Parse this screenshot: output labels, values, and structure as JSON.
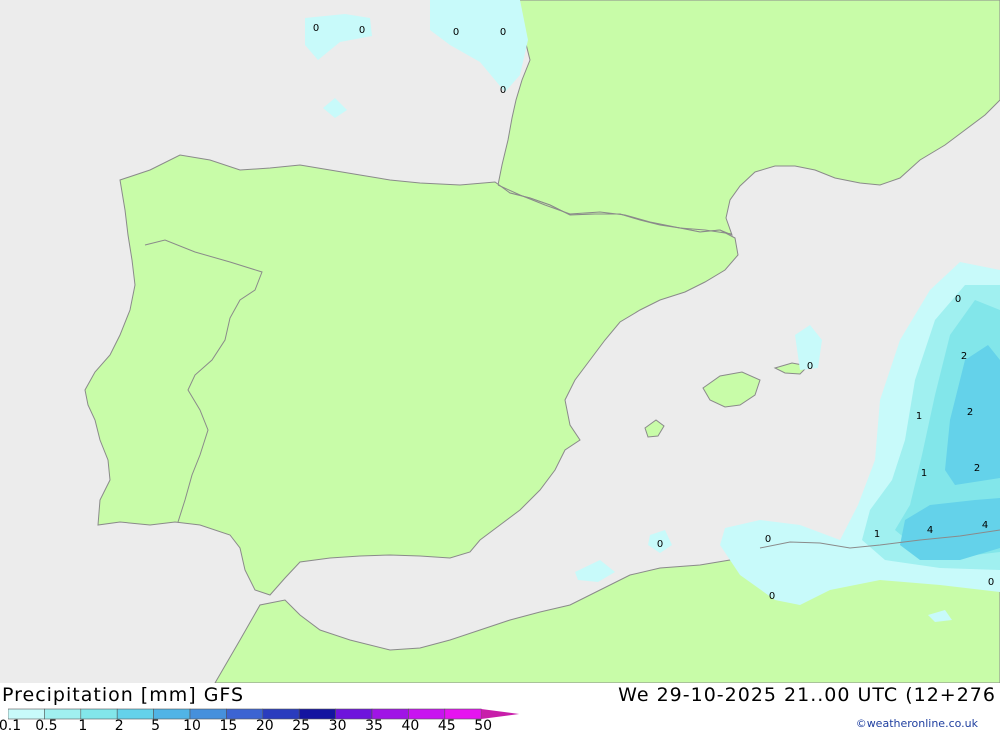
{
  "legend": {
    "title": "Precipitation [mm]",
    "model": "GFS",
    "datetime": "We 29-10-2025 21..00 UTC (12+276",
    "credit": "©weatheronline.co.uk",
    "scale_labels": [
      "0.1",
      "0.5",
      "1",
      "2",
      "5",
      "10",
      "15",
      "20",
      "25",
      "30",
      "35",
      "40",
      "45",
      "50"
    ],
    "scale_colors": [
      "#c8fafa",
      "#a0f0f0",
      "#82e6ea",
      "#64d2ea",
      "#50b4e6",
      "#4690dc",
      "#3c64d2",
      "#2a3cbe",
      "#1414a0",
      "#6e14dc",
      "#a014e6",
      "#c814f0",
      "#e614f0",
      "#c81eaa"
    ]
  },
  "map": {
    "colors": {
      "sea": "#ececec",
      "land": "#c8fca8",
      "border": "#8a8a8a"
    },
    "contour_values": [
      {
        "label": "0"
      },
      {
        "label": "0"
      },
      {
        "label": "0"
      },
      {
        "label": "0"
      },
      {
        "label": "0"
      },
      {
        "label": "0"
      },
      {
        "label": "2"
      },
      {
        "label": "1"
      },
      {
        "label": "2"
      },
      {
        "label": "1"
      },
      {
        "label": "2"
      },
      {
        "label": "0"
      },
      {
        "label": "0"
      },
      {
        "label": "1"
      },
      {
        "label": "4"
      },
      {
        "label": "4"
      },
      {
        "label": "0"
      },
      {
        "label": "0"
      },
      {
        "label": "0"
      }
    ]
  }
}
